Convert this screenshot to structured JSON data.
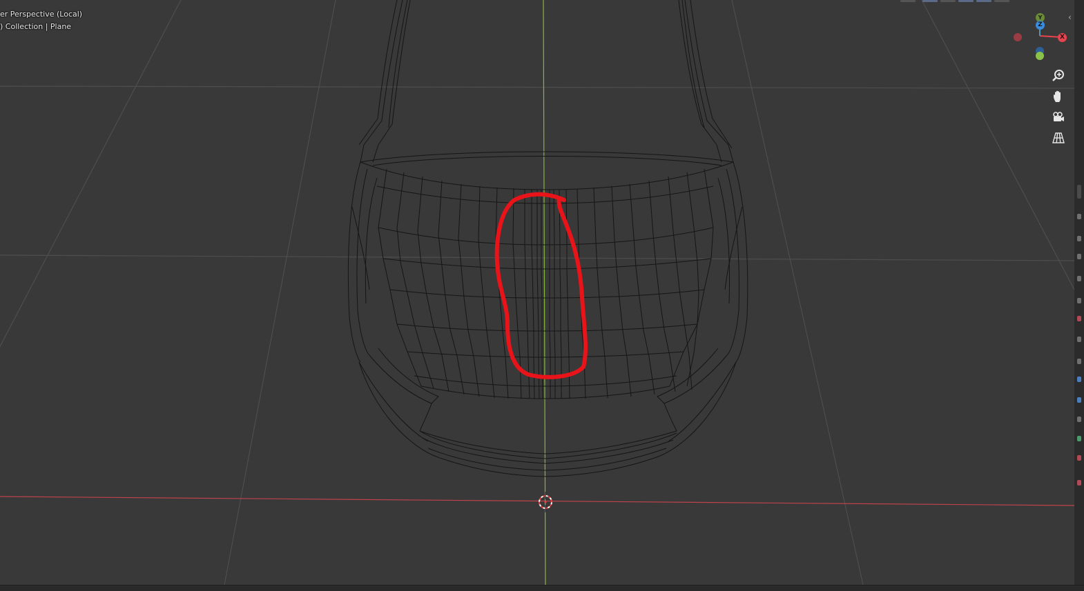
{
  "viewport": {
    "mode_text": "er Perspective (Local)",
    "object_info": ") Collection | Plane"
  },
  "gizmo": {
    "x_label": "X",
    "y_label": "Y",
    "z_label": "Z",
    "colors": {
      "x": "#e8434e",
      "y": "#8bc34a",
      "z": "#3a8dde",
      "neg_x": "#9a3c44",
      "neg_y": "#6b8c37",
      "neg_z": "#2f5f96"
    }
  },
  "nav_tools": [
    {
      "name": "zoom-icon"
    },
    {
      "name": "hand-pan-icon"
    },
    {
      "name": "camera-view-icon"
    },
    {
      "name": "perspective-grid-icon"
    }
  ],
  "annotation": {
    "color": "#e8141a",
    "kind": "hand-drawn circle highlighting center seam edge loops"
  },
  "colors": {
    "background": "#393939",
    "grid": "#4d4d4d",
    "x_axis": "#c8474f",
    "y_axis": "#7fb13a",
    "wire": "#141414"
  }
}
